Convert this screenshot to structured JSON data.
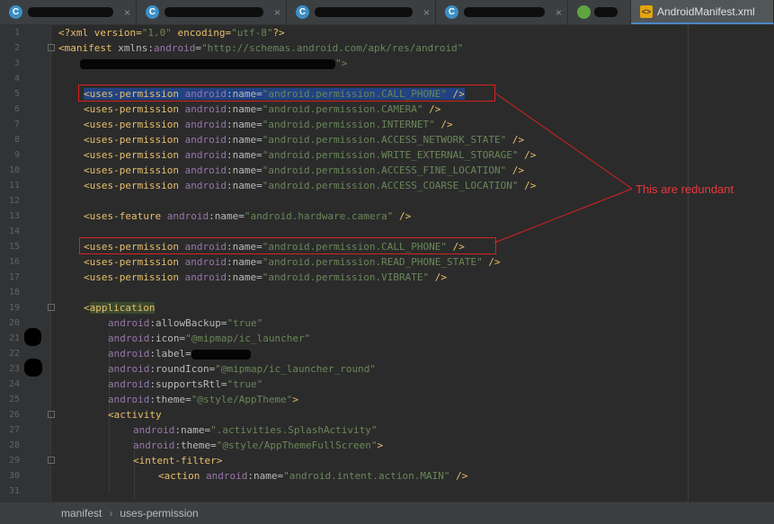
{
  "tabs": [
    {
      "label": "",
      "icon": "class-c-icon",
      "redacted": true,
      "redact_w": 100
    },
    {
      "label": "",
      "icon": "class-c-icon",
      "redacted": true,
      "redact_w": 118
    },
    {
      "label": "",
      "icon": "class-c-icon",
      "redacted": true,
      "redact_w": 120
    },
    {
      "label": "",
      "icon": "class-c-icon",
      "redacted": true,
      "redact_w": 90
    },
    {
      "label": "",
      "icon": "android-icon",
      "redacted": true,
      "redact_w": 30
    },
    {
      "label": "AndroidManifest.xml",
      "icon": "xml-file-icon",
      "active": true
    }
  ],
  "close_glyph": "×",
  "line_numbers": [
    "1",
    "2",
    "3",
    "4",
    "5",
    "6",
    "7",
    "8",
    "9",
    "10",
    "11",
    "12",
    "13",
    "14",
    "15",
    "16",
    "17",
    "18",
    "19",
    "20",
    "21",
    "22",
    "23",
    "24",
    "25",
    "26",
    "27",
    "28",
    "29",
    "30",
    "31"
  ],
  "code": {
    "l1_a": "<?xml version=",
    "l1_v1": "\"1.0\"",
    "l1_b": " encoding=",
    "l1_v2": "\"utf-8\"",
    "l1_c": "?>",
    "l2_tag": "<manifest ",
    "l2_attr": "xmlns:",
    "l2_ns": "android",
    "l2_eq": "=",
    "l2_val": "\"http://schemas.android.com/apk/res/android\"",
    "l3_tail": "\">",
    "perm_tag": "<uses-permission ",
    "ns": "android",
    "colon_name": ":name=",
    "close": " />",
    "l5_val": "\"android.permission.CALL_PHONE\"",
    "l6_val": "\"android.permission.CAMERA\"",
    "l7_val": "\"android.permission.INTERNET\"",
    "l8_val": "\"android.permission.ACCESS_NETWORK_STATE\"",
    "l9_val": "\"android.permission.WRITE_EXTERNAL_STORAGE\"",
    "l10_val": "\"android.permission.ACCESS_FINE_LOCATION\"",
    "l11_val": "\"android.permission.ACCESS_COARSE_LOCATION\"",
    "feature_tag": "<uses-feature ",
    "l13_val": "\"android.hardware.camera\"",
    "l15_val": "\"android.permission.CALL_PHONE\"",
    "l16_val": "\"android.permission.READ_PHONE_STATE\"",
    "l17_val": "\"android.permission.VIBRATE\"",
    "app_lt": "<",
    "app_tag": "application",
    "allowBackup_attr": ":allowBackup=",
    "allowBackup_val": "\"true\"",
    "icon_attr": ":icon=",
    "icon_val": "\"@mipmap/ic_launcher\"",
    "label_attr": ":label=",
    "roundIcon_attr": ":roundIcon=",
    "roundIcon_val": "\"@mipmap/ic_launcher_round\"",
    "supportsRtl_attr": ":supportsRtl=",
    "supportsRtl_val": "\"true\"",
    "theme_attr": ":theme=",
    "theme_val": "\"@style/AppTheme\"",
    "gt": ">",
    "activity_tag": "<activity",
    "act_name_val": "\".activities.SplashActivity\"",
    "act_theme_val": "\"@style/AppThemeFullScreen\"",
    "intent_tag": "<intent-filter>",
    "action_tag": "<action ",
    "action_val": "\"android.intent.action.MAIN\""
  },
  "annotation": {
    "text": "This are redundant",
    "color": "#e8383d"
  },
  "breadcrumb": {
    "items": [
      "manifest",
      "uses-permission"
    ],
    "separator": "›"
  },
  "colors": {
    "tag": "#e8bf6a",
    "namespace": "#9876aa",
    "value": "#6a8759",
    "background": "#2b2b2b"
  }
}
